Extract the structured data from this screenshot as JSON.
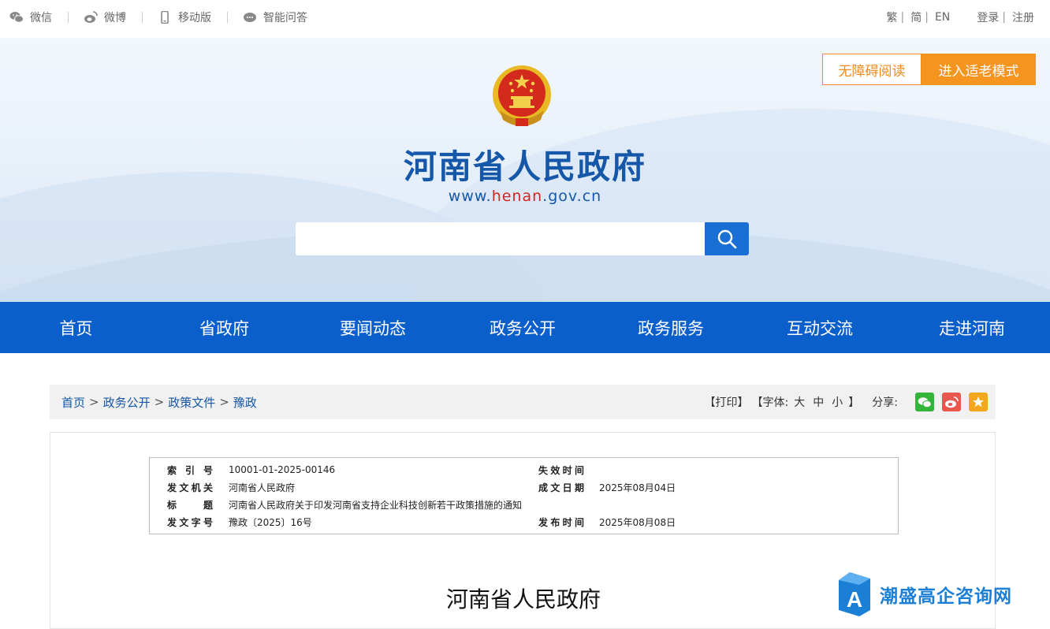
{
  "topbar": {
    "links": [
      {
        "label": "微信",
        "icon": "wechat-icon"
      },
      {
        "label": "微博",
        "icon": "weibo-icon"
      },
      {
        "label": "移动版",
        "icon": "mobile-icon"
      },
      {
        "label": "智能问答",
        "icon": "chat-icon"
      }
    ],
    "lang_trad": "繁",
    "lang_simp": "简",
    "lang_en": "EN",
    "login": "登录",
    "register": "注册"
  },
  "header": {
    "title": "河南省人民政府",
    "url_prefix": "www.",
    "url_highlight": "henan",
    "url_suffix": ".gov.cn",
    "accessibility_label": "无障碍阅读",
    "elder_mode_label": "进入适老模式",
    "search_placeholder": ""
  },
  "nav": {
    "items": [
      "首页",
      "省政府",
      "要闻动态",
      "政务公开",
      "政务服务",
      "互动交流",
      "走进河南"
    ]
  },
  "breadcrumb": {
    "items": [
      "首页",
      "政务公开",
      "政策文件",
      "豫政"
    ],
    "separator": ">"
  },
  "tools": {
    "print": "【打印】",
    "font_label": "【字体:",
    "font_large": "大",
    "font_medium": "中",
    "font_small": "小",
    "font_close": "】",
    "share_label": "分享:"
  },
  "meta": {
    "index_label": "索引号",
    "index_value": "10001-01-2025-00146",
    "expire_label": "失效时间",
    "expire_value": "",
    "issuer_label": "发文机关",
    "issuer_value": "河南省人民政府",
    "created_label": "成文日期",
    "created_value": "2025年08月04日",
    "title_label": "标题",
    "title_value": "河南省人民政府关于印发河南省支持企业科技创新若干政策措施的通知",
    "docno_label": "发文字号",
    "docno_value": "豫政〔2025〕16号",
    "published_label": "发布时间",
    "published_value": "2025年08月08日"
  },
  "document": {
    "heading": "河南省人民政府"
  },
  "watermark": {
    "text": "潮盛高企咨询网"
  },
  "colors": {
    "brand_blue": "#0b5fcb",
    "title_blue": "#1557a8",
    "accent_orange": "#f5941e",
    "url_red": "#d2261f"
  }
}
